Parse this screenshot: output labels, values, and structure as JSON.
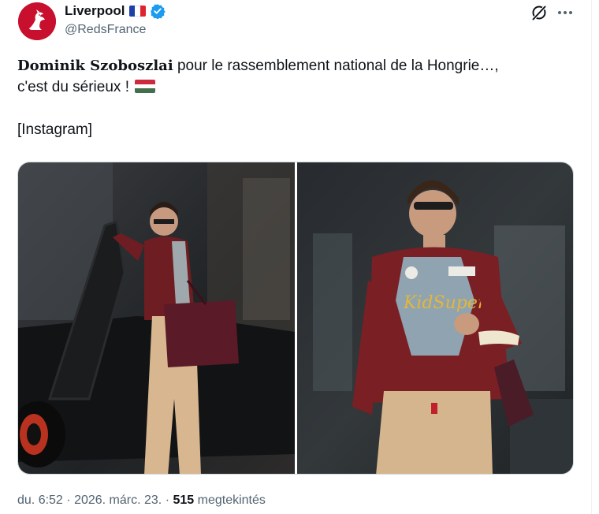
{
  "author": {
    "name": "Liverpool",
    "handle": "@RedsFrance",
    "verified": true,
    "flag": "france-flag",
    "avatar_color": "#c8102e"
  },
  "icons": {
    "grok": "grok-icon",
    "more": "more-icon"
  },
  "tweet": {
    "name_bold": "Dominik Szoboszlai",
    "text_line1": " pour le rassemblement national de la Hongrie…,",
    "text_line2": "c'est du sérieux !",
    "flag": "hungary-flag",
    "source": "[Instagram]"
  },
  "media": {
    "count": 2,
    "photos": [
      "photo-1",
      "photo-2"
    ]
  },
  "meta": {
    "time": "du. 6:52",
    "date": "2026. márc. 23.",
    "separator": "·",
    "views": "515",
    "views_label": "megtekintés"
  },
  "colors": {
    "accent_blue": "#1d9bf0",
    "text_primary": "#0f1419",
    "text_secondary": "#536471",
    "border": "#cfd9de"
  }
}
